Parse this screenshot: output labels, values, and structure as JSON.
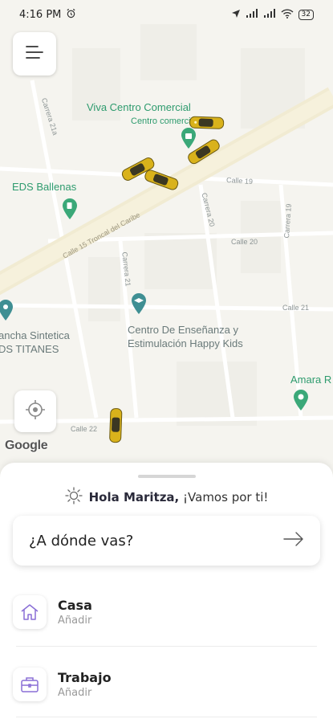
{
  "status_bar": {
    "time": "4:16 PM",
    "battery": "32"
  },
  "map": {
    "pois": [
      {
        "id": "viva",
        "name": "Viva Centro Comercial",
        "sub": "Centro comerci..."
      },
      {
        "id": "eds",
        "name": "EDS Ballenas"
      },
      {
        "id": "cancha",
        "line1": "ancha Sintetica",
        "line2": "DS TITANES"
      },
      {
        "id": "centro",
        "line1": "Centro De Enseñanza y",
        "line2": "Estimulación Happy Kids"
      },
      {
        "id": "amara",
        "name": "Amara R"
      }
    ],
    "streets": {
      "carrera21a": "Carrera 21a",
      "calle19": "Calle 19",
      "carrera20": "Carrera 20",
      "carrera19": "Carrera 19",
      "troncal": "Calle 15 Troncal del Caribe",
      "calle20": "Calle 20",
      "carrera21": "Carrera 21",
      "calle21": "Calle 21",
      "calle22": "Calle 22"
    },
    "attribution": "Google"
  },
  "sheet": {
    "greeting_name": "Hola Maritza,",
    "greeting_rest": " ¡Vamos por ti!",
    "destination_prompt": "¿A dónde vas?",
    "favorites": [
      {
        "title": "Casa",
        "subtitle": "Añadir",
        "icon": "home-icon"
      },
      {
        "title": "Trabajo",
        "subtitle": "Añadir",
        "icon": "briefcase-icon"
      }
    ]
  },
  "colors": {
    "accent": "#8a6fd6",
    "taxi": "#d9b21b",
    "road": "#f0ebd6",
    "poi_green": "#2e9b6e"
  }
}
